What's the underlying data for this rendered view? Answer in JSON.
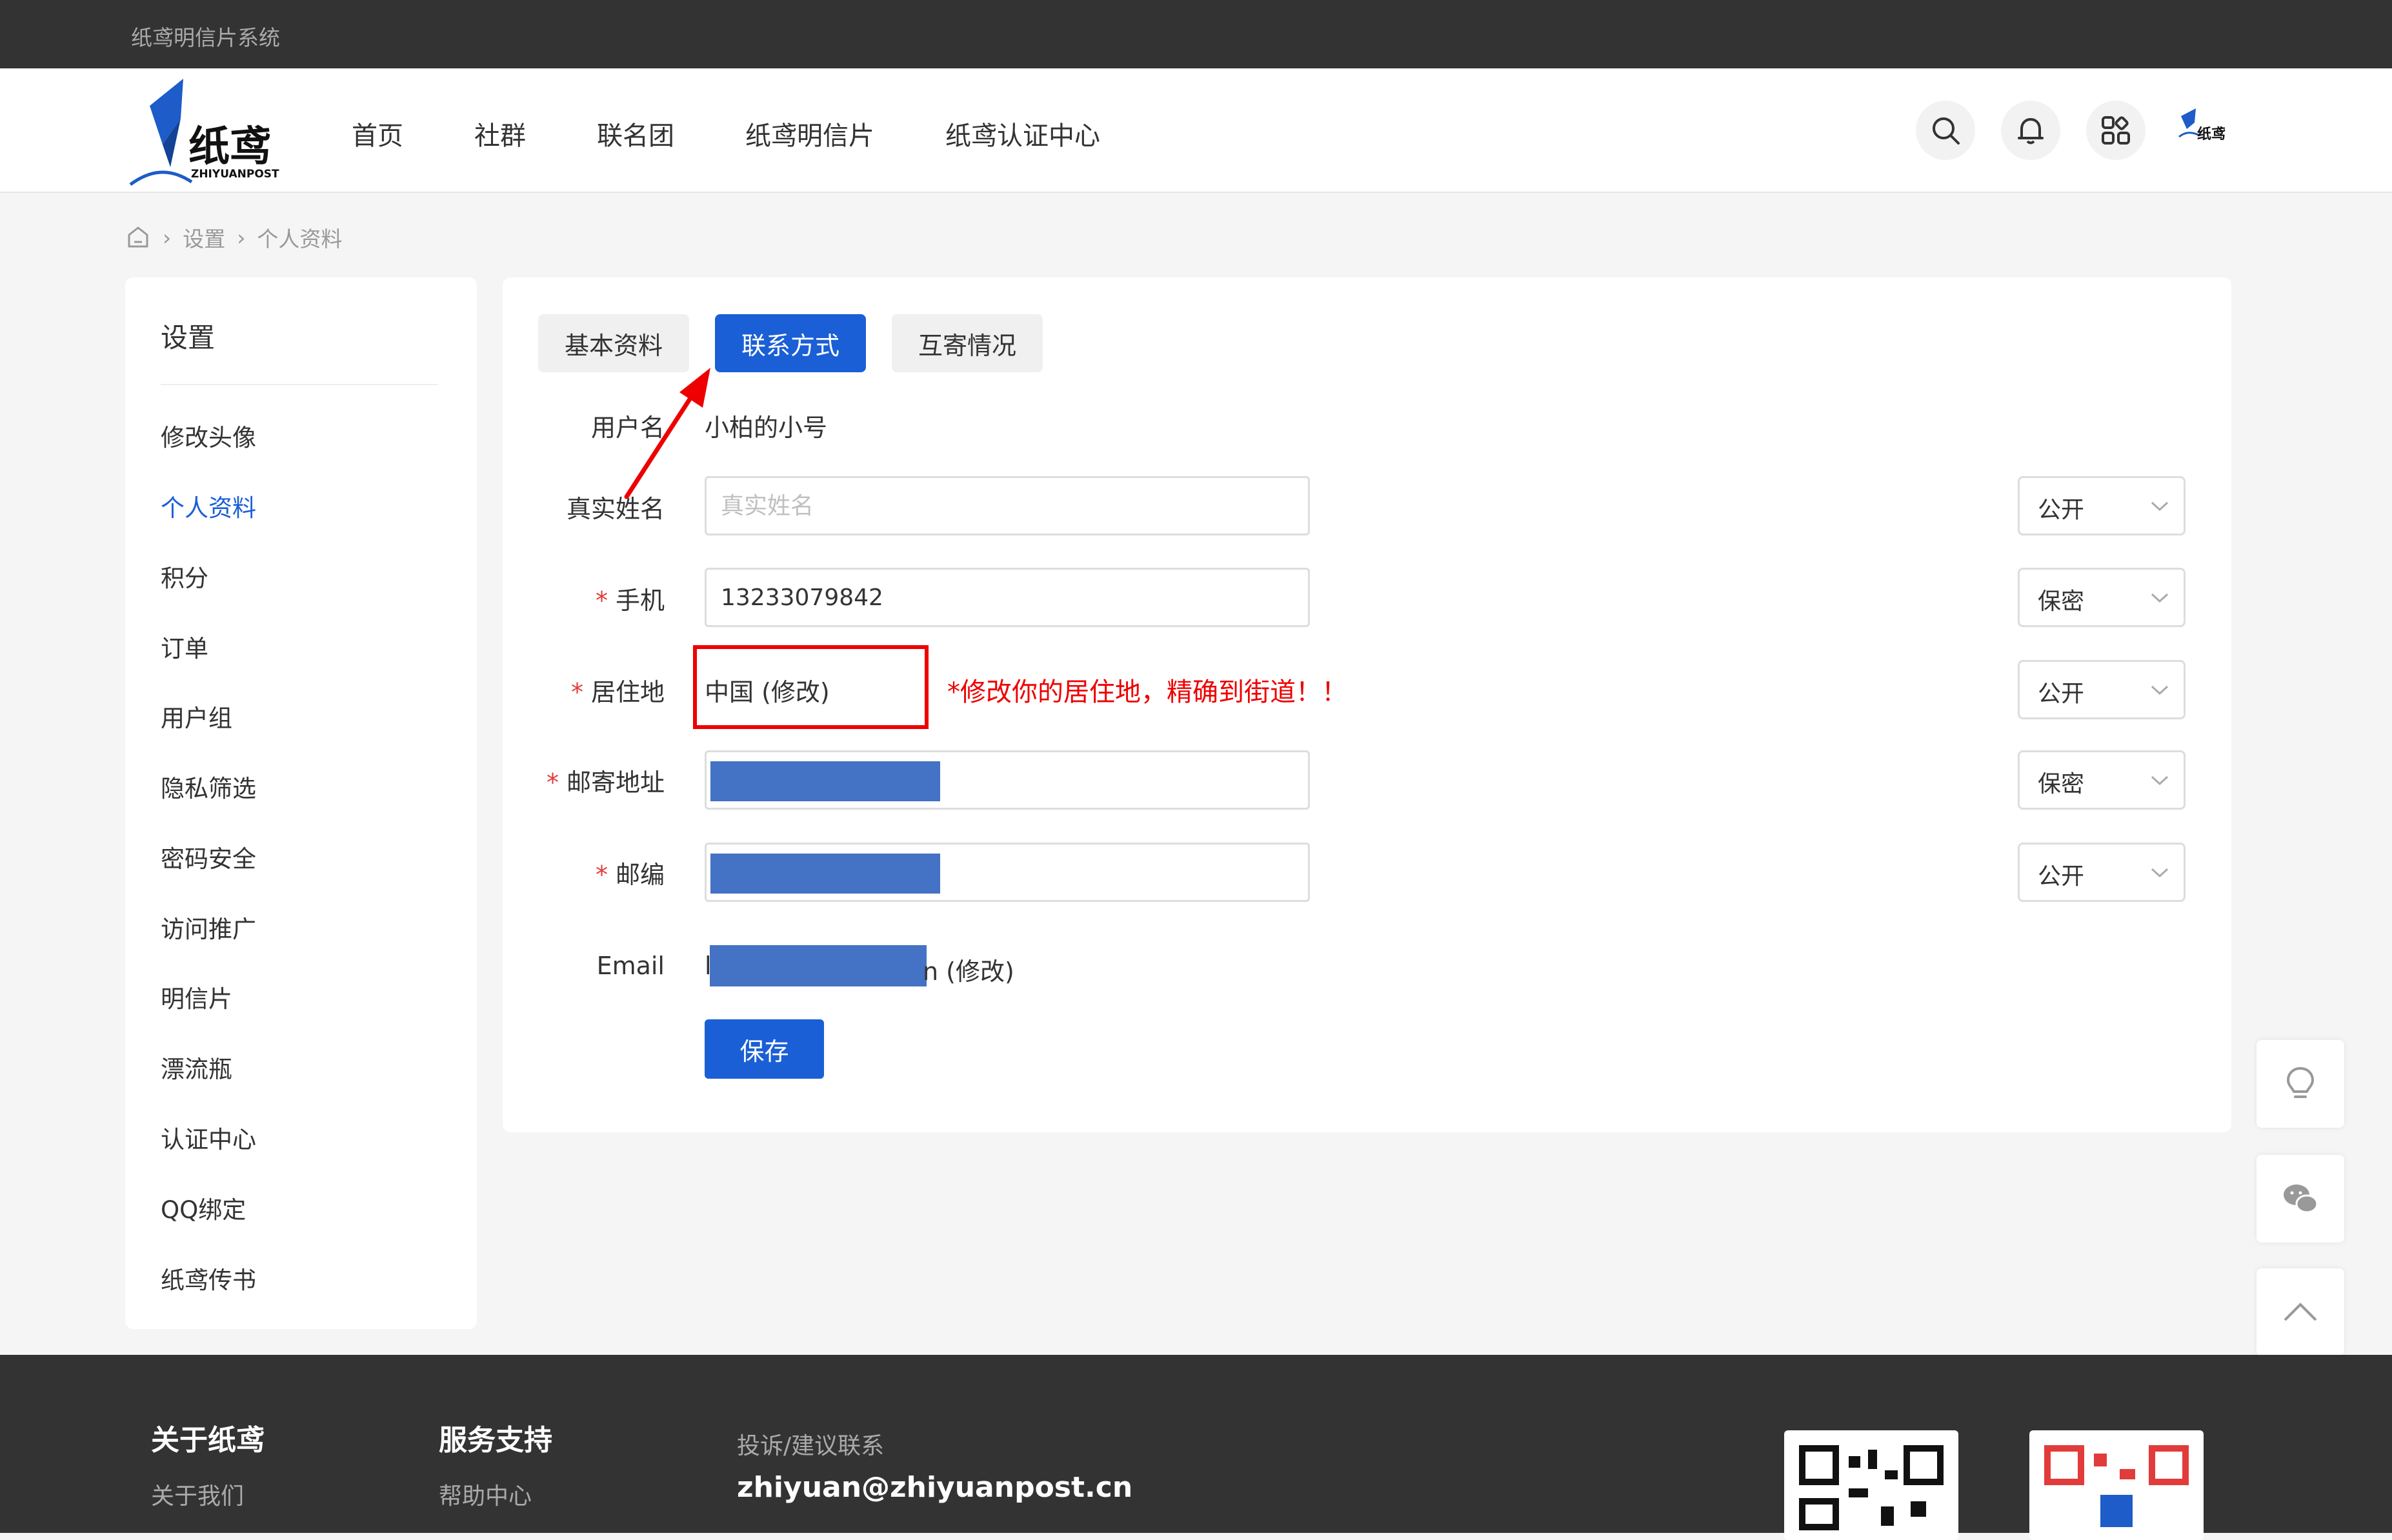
{
  "topbar": {
    "system_name": "纸鸢明信片系统"
  },
  "header": {
    "logo_text": "纸鸢",
    "logo_sub": "ZHIYUANPOST",
    "nav": [
      "首页",
      "社群",
      "联名团",
      "纸鸢明信片",
      "纸鸢认证中心"
    ],
    "avatar_text": "纸鸢"
  },
  "breadcrumb": {
    "items": [
      "设置",
      "个人资料"
    ],
    "separator": "›"
  },
  "sidebar": {
    "title": "设置",
    "items": [
      "修改头像",
      "个人资料",
      "积分",
      "订单",
      "用户组",
      "隐私筛选",
      "密码安全",
      "访问推广",
      "明信片",
      "漂流瓶",
      "认证中心",
      "QQ绑定",
      "纸鸢传书"
    ],
    "active_index": 1
  },
  "tabs": [
    "基本资料",
    "联系方式",
    "互寄情况"
  ],
  "active_tab": 1,
  "form": {
    "username_label": "用户名",
    "username_value": "小柏的小号",
    "realname_label": "真实姓名",
    "realname_placeholder": "真实姓名",
    "realname_privacy": "公开",
    "required_mark": "*",
    "phone_label": "手机",
    "phone_value": "13233079842",
    "phone_privacy": "保密",
    "residence_label": "居住地",
    "residence_value": "中国 (修改)",
    "residence_privacy": "公开",
    "address_label": "邮寄地址",
    "address_privacy": "保密",
    "zip_label": "邮编",
    "zip_privacy": "公开",
    "email_label": "Email",
    "email_prefix": "l",
    "email_suffix": "n (修改)",
    "save_label": "保存"
  },
  "annotation": {
    "text": "*修改你的居住地，精确到街道！！",
    "color": "#e00000"
  },
  "footer": {
    "col1_title": "关于纸鸢",
    "col1_link": "关于我们",
    "col2_title": "服务支持",
    "col2_link": "帮助中心",
    "contact_label": "投诉/建议联系",
    "contact_email": "zhiyuan@zhiyuanpost.cn"
  },
  "colors": {
    "primary": "#1a5fd6",
    "redact": "#4472c4",
    "star": "#e23b3b"
  }
}
